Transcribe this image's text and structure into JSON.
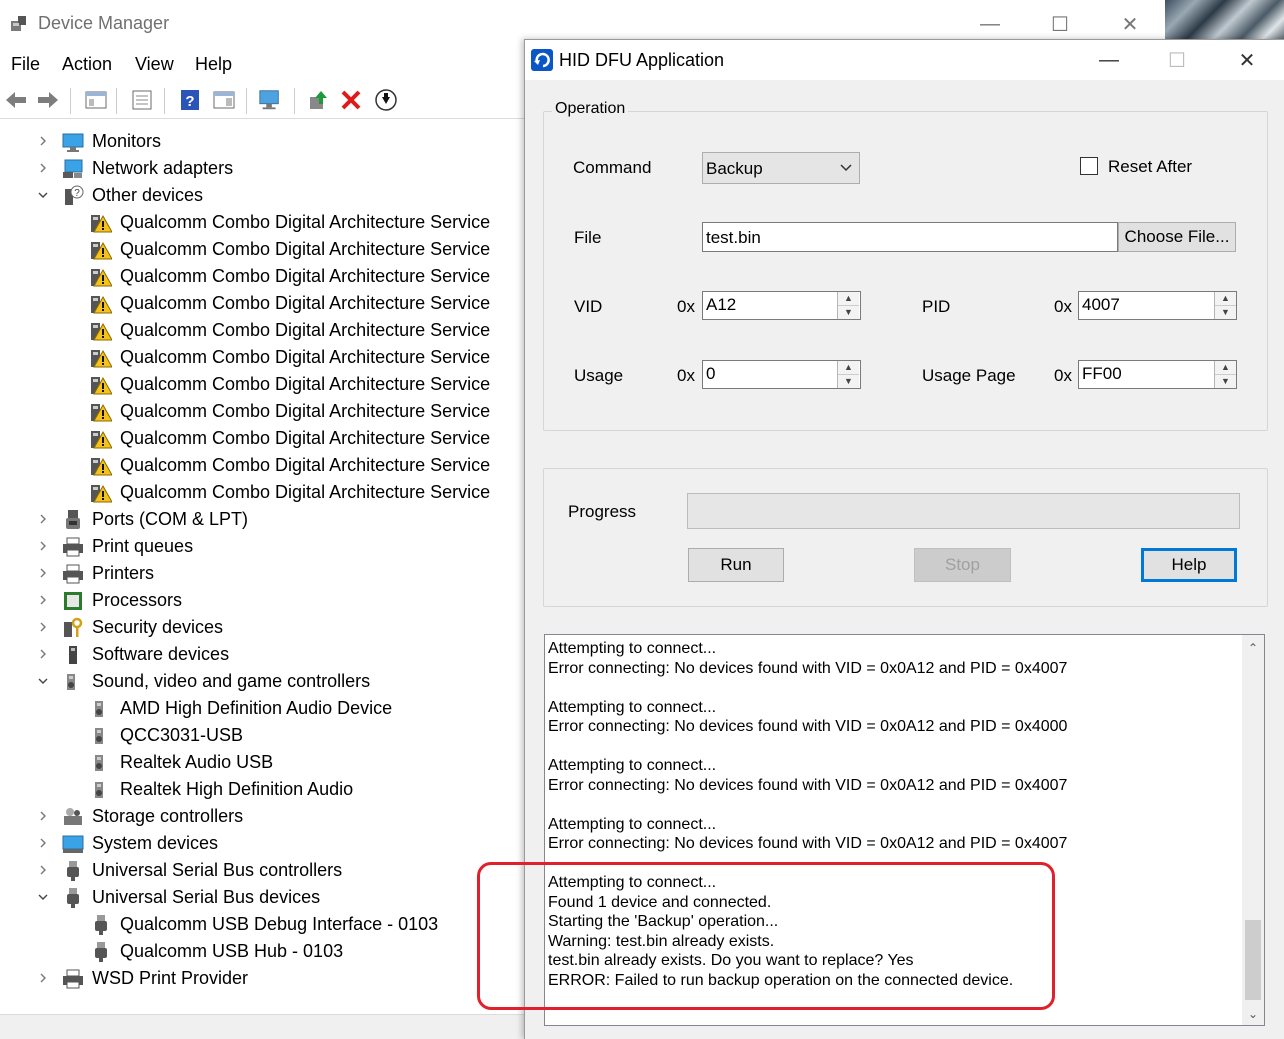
{
  "device_manager": {
    "title": "Device Manager",
    "menu": [
      "File",
      "Action",
      "View",
      "Help"
    ],
    "tree": [
      {
        "label": "Monitors",
        "level": 0,
        "expanded": false,
        "icon": "monitor-icon"
      },
      {
        "label": "Network adapters",
        "level": 0,
        "expanded": false,
        "icon": "network-adapter-icon"
      },
      {
        "label": "Other devices",
        "level": 0,
        "expanded": true,
        "icon": "unknown-device-icon"
      },
      {
        "label": "Qualcomm Combo Digital Architecture Service",
        "level": 1,
        "icon": "warning-device-icon"
      },
      {
        "label": "Qualcomm Combo Digital Architecture Service",
        "level": 1,
        "icon": "warning-device-icon"
      },
      {
        "label": "Qualcomm Combo Digital Architecture Service",
        "level": 1,
        "icon": "warning-device-icon"
      },
      {
        "label": "Qualcomm Combo Digital Architecture Service",
        "level": 1,
        "icon": "warning-device-icon"
      },
      {
        "label": "Qualcomm Combo Digital Architecture Service",
        "level": 1,
        "icon": "warning-device-icon"
      },
      {
        "label": "Qualcomm Combo Digital Architecture Service",
        "level": 1,
        "icon": "warning-device-icon"
      },
      {
        "label": "Qualcomm Combo Digital Architecture Service",
        "level": 1,
        "icon": "warning-device-icon"
      },
      {
        "label": "Qualcomm Combo Digital Architecture Service",
        "level": 1,
        "icon": "warning-device-icon"
      },
      {
        "label": "Qualcomm Combo Digital Architecture Service",
        "level": 1,
        "icon": "warning-device-icon"
      },
      {
        "label": "Qualcomm Combo Digital Architecture Service",
        "level": 1,
        "icon": "warning-device-icon"
      },
      {
        "label": "Qualcomm Combo Digital Architecture Service",
        "level": 1,
        "icon": "warning-device-icon"
      },
      {
        "label": "Ports (COM & LPT)",
        "level": 0,
        "expanded": false,
        "icon": "port-icon"
      },
      {
        "label": "Print queues",
        "level": 0,
        "expanded": false,
        "icon": "printer-icon"
      },
      {
        "label": "Printers",
        "level": 0,
        "expanded": false,
        "icon": "printer-icon"
      },
      {
        "label": "Processors",
        "level": 0,
        "expanded": false,
        "icon": "processor-icon"
      },
      {
        "label": "Security devices",
        "level": 0,
        "expanded": false,
        "icon": "security-device-icon"
      },
      {
        "label": "Software devices",
        "level": 0,
        "expanded": false,
        "icon": "software-device-icon"
      },
      {
        "label": "Sound, video and game controllers",
        "level": 0,
        "expanded": true,
        "icon": "speaker-icon"
      },
      {
        "label": "AMD High Definition Audio Device",
        "level": 1,
        "icon": "speaker-icon"
      },
      {
        "label": "QCC3031-USB",
        "level": 1,
        "icon": "speaker-icon"
      },
      {
        "label": "Realtek Audio USB",
        "level": 1,
        "icon": "speaker-icon"
      },
      {
        "label": "Realtek High Definition Audio",
        "level": 1,
        "icon": "speaker-icon"
      },
      {
        "label": "Storage controllers",
        "level": 0,
        "expanded": false,
        "icon": "storage-controller-icon"
      },
      {
        "label": "System devices",
        "level": 0,
        "expanded": false,
        "icon": "system-device-icon"
      },
      {
        "label": "Universal Serial Bus controllers",
        "level": 0,
        "expanded": false,
        "icon": "usb-icon"
      },
      {
        "label": "Universal Serial Bus devices",
        "level": 0,
        "expanded": true,
        "icon": "usb-icon"
      },
      {
        "label": "Qualcomm USB Debug Interface - 0103",
        "level": 1,
        "icon": "usb-icon"
      },
      {
        "label": "Qualcomm USB Hub - 0103",
        "level": 1,
        "icon": "usb-icon"
      },
      {
        "label": "WSD Print Provider",
        "level": 0,
        "expanded": false,
        "icon": "printer-icon"
      }
    ]
  },
  "dfu": {
    "title": "HID DFU Application",
    "operation": {
      "group_label": "Operation",
      "command_label": "Command",
      "command_value": "Backup",
      "reset_after_label": "Reset After",
      "reset_after_checked": false,
      "file_label": "File",
      "file_value": "test.bin",
      "choose_file_label": "Choose File...",
      "vid_label": "VID",
      "vid_prefix": "0x",
      "vid_value": "A12",
      "pid_label": "PID",
      "pid_prefix": "0x",
      "pid_value": "4007",
      "usage_label": "Usage",
      "usage_prefix": "0x",
      "usage_value": "0",
      "usage_page_label": "Usage Page",
      "usage_page_prefix": "0x",
      "usage_page_value": "FF00"
    },
    "progress": {
      "label": "Progress",
      "run_label": "Run",
      "stop_label": "Stop",
      "help_label": "Help"
    },
    "log": "Attempting to connect...\nError connecting: No devices found with VID = 0x0A12 and PID = 0x4007\n\nAttempting to connect...\nError connecting: No devices found with VID = 0x0A12 and PID = 0x4000\n\nAttempting to connect...\nError connecting: No devices found with VID = 0x0A12 and PID = 0x4007\n\nAttempting to connect...\nError connecting: No devices found with VID = 0x0A12 and PID = 0x4007\n\nAttempting to connect...\nFound 1 device and connected.\nStarting the 'Backup' operation...\nWarning: test.bin already exists.\ntest.bin already exists. Do you want to replace? Yes\nERROR: Failed to run backup operation on the connected device.",
    "highlight_color": "#e0202a"
  }
}
